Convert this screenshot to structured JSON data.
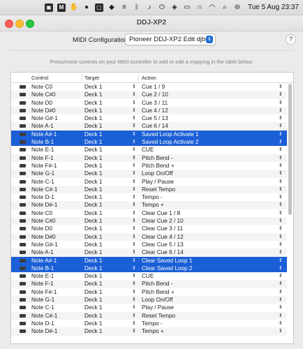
{
  "menubar": {
    "icons": [
      "browser-icon",
      "malwarebytes-icon",
      "hand-icon",
      "circle-dot-icon",
      "box-icon",
      "drop-icon",
      "sliders-icon",
      "bluetooth-icon",
      "music-note-icon",
      "power-icon",
      "tag-icon",
      "cast-icon",
      "headphones-icon",
      "wifi-icon",
      "search-icon",
      "control-center-icon"
    ],
    "clock": "Tue 5 Aug  23:37"
  },
  "window": {
    "title": "DDJ-XP2"
  },
  "config": {
    "label": "MIDI Configuration:",
    "selected": "Pioneer DDJ-XP2 Edit djbo",
    "stepper_glyph": "⇕",
    "help_glyph": "?"
  },
  "hint": "Press/move controls on your MIDI controller to add or edit a mapping in the table below.",
  "table": {
    "columns": {
      "control": "Control",
      "target": "Target",
      "action": "Action"
    },
    "stepper_glyph": "⇕",
    "rows": [
      {
        "control": "Note C0",
        "target": "Deck 1",
        "action": "Cue 1 / 9",
        "selected": false
      },
      {
        "control": "Note C#0",
        "target": "Deck 1",
        "action": "Cue 2 / 10",
        "selected": false
      },
      {
        "control": "Note D0",
        "target": "Deck 1",
        "action": "Cue 3 / 11",
        "selected": false
      },
      {
        "control": "Note D#0",
        "target": "Deck 1",
        "action": "Cue 4 / 12",
        "selected": false
      },
      {
        "control": "Note G#-1",
        "target": "Deck 1",
        "action": "Cue 5 / 13",
        "selected": false
      },
      {
        "control": "Note A-1",
        "target": "Deck 1",
        "action": "Cue 6 / 14",
        "selected": false
      },
      {
        "control": "Note A#-1",
        "target": "Deck 1",
        "action": "Saved Loop Activate 1",
        "selected": true
      },
      {
        "control": "Note B-1",
        "target": "Deck 1",
        "action": "Saved Loop Activate 2",
        "selected": true
      },
      {
        "control": "Note E-1",
        "target": "Deck 1",
        "action": "CUE",
        "selected": false
      },
      {
        "control": "Note F-1",
        "target": "Deck 1",
        "action": "Pitch Bend -",
        "selected": false
      },
      {
        "control": "Note F#-1",
        "target": "Deck 1",
        "action": "Pitch Bend +",
        "selected": false
      },
      {
        "control": "Note G-1",
        "target": "Deck 1",
        "action": "Loop On/Off",
        "selected": false
      },
      {
        "control": "Note C-1",
        "target": "Deck 1",
        "action": "Play / Pause",
        "selected": false
      },
      {
        "control": "Note C#-1",
        "target": "Deck 1",
        "action": "Reset Tempo",
        "selected": false
      },
      {
        "control": "Note D-1",
        "target": "Deck 1",
        "action": "Tempo -",
        "selected": false
      },
      {
        "control": "Note D#-1",
        "target": "Deck 1",
        "action": "Tempo +",
        "selected": false
      },
      {
        "control": "Note C0",
        "target": "Deck 1",
        "action": "Clear Cue 1 / 8",
        "selected": false
      },
      {
        "control": "Note C#0",
        "target": "Deck 1",
        "action": "Clear Cue 2 / 10",
        "selected": false
      },
      {
        "control": "Note D0",
        "target": "Deck 1",
        "action": "Clear Cue 3 / 11",
        "selected": false
      },
      {
        "control": "Note D#0",
        "target": "Deck 1",
        "action": "Clear Cue 4 / 12",
        "selected": false
      },
      {
        "control": "Note G#-1",
        "target": "Deck 1",
        "action": "Clear Cue 5 / 13",
        "selected": false
      },
      {
        "control": "Note A-1",
        "target": "Deck 1",
        "action": "Clear Cue 6 / 14",
        "selected": false
      },
      {
        "control": "Note A#-1",
        "target": "Deck 1",
        "action": "Clear Saved Loop 1",
        "selected": true
      },
      {
        "control": "Note B-1",
        "target": "Deck 1",
        "action": "Clear Saved Loop 2",
        "selected": true
      },
      {
        "control": "Note E-1",
        "target": "Deck 1",
        "action": "CUE",
        "selected": false
      },
      {
        "control": "Note F-1",
        "target": "Deck 1",
        "action": "Pitch Bend -",
        "selected": false
      },
      {
        "control": "Note F#-1",
        "target": "Deck 1",
        "action": "Pitch Bend +",
        "selected": false
      },
      {
        "control": "Note G-1",
        "target": "Deck 1",
        "action": "Loop On/Off",
        "selected": false
      },
      {
        "control": "Note C-1",
        "target": "Deck 1",
        "action": "Play / Pause",
        "selected": false
      },
      {
        "control": "Note C#-1",
        "target": "Deck 1",
        "action": "Reset Tempo",
        "selected": false
      },
      {
        "control": "Note D-1",
        "target": "Deck 1",
        "action": "Tempo -",
        "selected": false
      },
      {
        "control": "Note D#-1",
        "target": "Deck 1",
        "action": "Tempo +",
        "selected": false
      }
    ]
  },
  "colors": {
    "selection": "#1b5fd6",
    "accent": "#1f6fd6"
  }
}
